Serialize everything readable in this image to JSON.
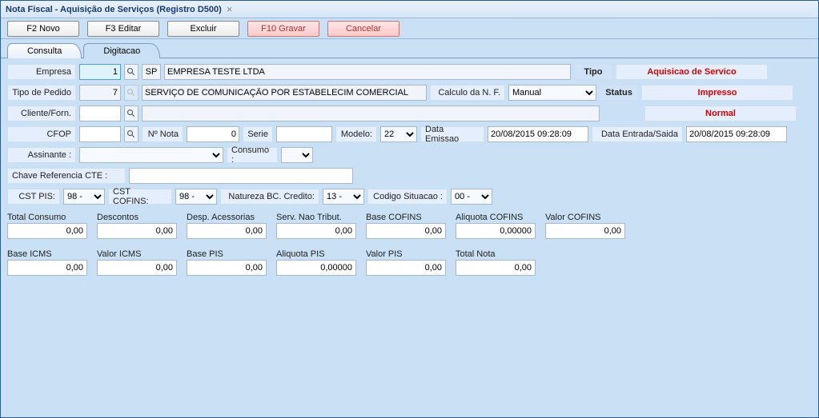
{
  "window": {
    "title": "Nota Fiscal - Aquisição de Serviços (Registro D500)"
  },
  "toolbar": {
    "novo": "F2 Novo",
    "editar": "F3 Editar",
    "excluir": "Excluir",
    "gravar": "F10 Gravar",
    "cancelar": "Cancelar"
  },
  "tabs": {
    "consulta": "Consulta",
    "digitacao": "Digitacao"
  },
  "labels": {
    "empresa": "Empresa",
    "tipo_pedido": "Tipo de Pedido",
    "cliente_forn": "Cliente/Forn.",
    "cfop": "CFOP",
    "num_nota": "Nº Nota",
    "serie": "Serie",
    "modelo": "Modelo:",
    "data_emissao": "Data Emissao",
    "data_entrada_saida": "Data Entrada/Saida",
    "assinante": "Assinante :",
    "consumo": "Consumo :",
    "chave_ref": "Chave Referencia CTE :",
    "cst_pis": "CST PIS:",
    "cst_cofins": "CST COFINS:",
    "natureza_bc": "Natureza BC. Credito:",
    "codigo_situacao": "Codigo Situacao :",
    "calculo_nf": "Calculo da N. F.",
    "tipo_head": "Tipo",
    "status_head": "Status"
  },
  "fields": {
    "empresa_id": "1",
    "empresa_uf": "SP",
    "empresa_nome": "EMPRESA TESTE LTDA",
    "tipo_pedido_id": "7",
    "tipo_pedido_desc": "SERVIÇO DE COMUNICAÇÃO POR ESTABELECIM COMERCIAL",
    "calculo_nf": "Manual",
    "cliente_forn": "",
    "cfop": "",
    "num_nota": "0",
    "serie": "",
    "modelo": "22",
    "data_emissao": "20/08/2015 09:28:09",
    "data_entrada_saida": "20/08/2015 09:28:09",
    "assinante": "",
    "consumo_sel": "",
    "chave_ref": "",
    "cst_pis": "98 -",
    "cst_cofins": "98 -",
    "natureza_bc": "13 -",
    "codigo_situacao": "00 -"
  },
  "status": {
    "tipo": "Aquisicao de Servico",
    "status": "Impresso",
    "obs": "Normal"
  },
  "totals": [
    {
      "label": "Total Consumo",
      "value": "0,00"
    },
    {
      "label": "Descontos",
      "value": "0,00"
    },
    {
      "label": "Desp. Acessorias",
      "value": "0,00"
    },
    {
      "label": "Serv. Nao Tribut.",
      "value": "0,00"
    },
    {
      "label": "Base COFINS",
      "value": "0,00"
    },
    {
      "label": "Aliquota COFINS",
      "value": "0,00000"
    },
    {
      "label": "Valor COFINS",
      "value": "0,00"
    },
    {
      "label": "Base ICMS",
      "value": "0,00"
    },
    {
      "label": "Valor ICMS",
      "value": "0,00"
    },
    {
      "label": "Base PIS",
      "value": "0,00"
    },
    {
      "label": "Aliquota PIS",
      "value": "0,00000"
    },
    {
      "label": "Valor PIS",
      "value": "0,00"
    },
    {
      "label": "Total Nota",
      "value": "0,00"
    }
  ]
}
